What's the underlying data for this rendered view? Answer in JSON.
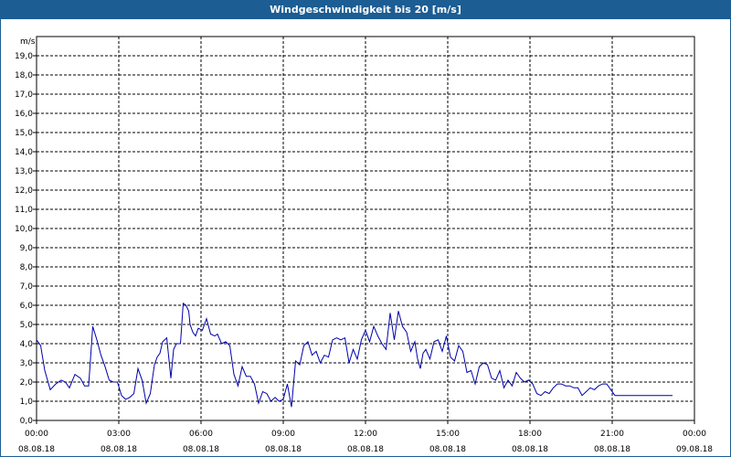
{
  "chart_data": {
    "type": "line",
    "title": "Windgeschwindigkeit bis 20 [m/s]",
    "unit_label": "m/s",
    "ylim": [
      0,
      20
    ],
    "y_ticks": [
      0.0,
      1.0,
      2.0,
      3.0,
      4.0,
      5.0,
      6.0,
      7.0,
      8.0,
      9.0,
      10.0,
      11.0,
      12.0,
      13.0,
      14.0,
      15.0,
      16.0,
      17.0,
      18.0,
      19.0
    ],
    "y_tick_labels": [
      "0,0",
      "1,0",
      "2,0",
      "3,0",
      "4,0",
      "5,0",
      "6,0",
      "7,0",
      "8,0",
      "9,0",
      "10,0",
      "11,0",
      "12,0",
      "13,0",
      "14,0",
      "15,0",
      "16,0",
      "17,0",
      "18,0",
      "19,0"
    ],
    "xlim_hours": [
      0,
      24
    ],
    "x_ticks_hours": [
      0,
      3,
      6,
      9,
      12,
      15,
      18,
      21,
      24
    ],
    "x_tick_times": [
      "00:00",
      "03:00",
      "06:00",
      "09:00",
      "12:00",
      "15:00",
      "18:00",
      "21:00",
      "00:00"
    ],
    "x_tick_dates": [
      "08.08.18",
      "08.08.18",
      "08.08.18",
      "08.08.18",
      "08.08.18",
      "08.08.18",
      "08.08.18",
      "08.08.18",
      "09.08.18"
    ],
    "grid": true,
    "line_color": "#0000aa",
    "series": [
      {
        "x_hours": [
          0.0,
          0.15,
          0.3,
          0.5,
          0.7,
          0.9,
          1.05,
          1.2,
          1.4,
          1.6,
          1.75,
          1.9,
          2.05,
          2.2,
          2.35,
          2.5,
          2.65,
          2.8,
          2.95,
          3.1,
          3.25,
          3.4,
          3.55,
          3.7,
          3.85,
          4.0,
          4.15,
          4.3,
          4.4,
          4.5,
          4.6,
          4.75,
          4.9,
          5.0,
          5.1,
          5.25,
          5.35,
          5.45,
          5.55,
          5.6,
          5.7,
          5.8,
          5.9,
          6.05,
          6.2,
          6.35,
          6.5,
          6.6,
          6.75,
          6.9,
          7.05,
          7.2,
          7.35,
          7.5,
          7.65,
          7.8,
          7.95,
          8.1,
          8.25,
          8.4,
          8.55,
          8.7,
          8.85,
          9.0,
          9.15,
          9.3,
          9.45,
          9.6,
          9.75,
          9.9,
          10.05,
          10.2,
          10.35,
          10.5,
          10.65,
          10.8,
          10.95,
          11.1,
          11.25,
          11.4,
          11.55,
          11.7,
          11.85,
          12.0,
          12.15,
          12.3,
          12.45,
          12.6,
          12.75,
          12.9,
          13.05,
          13.2,
          13.35,
          13.5,
          13.65,
          13.8,
          13.9,
          14.0,
          14.1,
          14.2,
          14.35,
          14.5,
          14.65,
          14.8,
          14.95,
          15.1,
          15.25,
          15.4,
          15.55,
          15.7,
          15.85,
          16.0,
          16.15,
          16.3,
          16.45,
          16.6,
          16.75,
          16.9,
          17.05,
          17.2,
          17.35,
          17.5,
          17.65,
          17.8,
          17.95,
          18.1,
          18.25,
          18.4,
          18.55,
          18.7,
          18.85,
          19.0,
          19.15,
          19.3,
          19.45,
          19.6,
          19.75,
          19.9,
          20.05,
          20.2,
          20.35,
          20.5,
          20.65,
          20.8,
          20.95,
          21.1,
          21.25,
          21.4,
          21.55,
          21.7,
          21.85,
          22.0,
          22.15,
          22.3,
          22.45,
          22.6,
          22.75,
          22.9,
          23.05,
          23.2,
          23.35,
          23.5,
          23.65,
          23.8
        ],
        "y": [
          4.2,
          3.9,
          2.6,
          1.6,
          1.9,
          2.1,
          2.0,
          1.7,
          2.4,
          2.2,
          1.8,
          1.8,
          4.9,
          4.2,
          3.4,
          2.8,
          2.1,
          2.0,
          2.0,
          1.3,
          1.1,
          1.2,
          1.4,
          2.7,
          2.1,
          0.9,
          1.4,
          2.9,
          3.3,
          3.5,
          4.1,
          4.3,
          2.2,
          3.7,
          4.0,
          4.0,
          6.1,
          6.0,
          5.7,
          5.0,
          4.6,
          4.4,
          4.8,
          4.7,
          5.3,
          4.5,
          4.4,
          4.5,
          4.0,
          4.1,
          3.9,
          2.4,
          1.8,
          2.8,
          2.3,
          2.3,
          1.9,
          0.9,
          1.5,
          1.4,
          1.0,
          1.2,
          1.0,
          1.1,
          1.9,
          0.7,
          3.1,
          2.9,
          3.9,
          4.1,
          3.4,
          3.6,
          3.0,
          3.4,
          3.3,
          4.2,
          4.3,
          4.2,
          4.3,
          3.0,
          3.7,
          3.2,
          4.2,
          4.7,
          4.1,
          4.9,
          4.4,
          4.0,
          3.7,
          5.6,
          4.2,
          5.7,
          4.9,
          4.6,
          3.6,
          4.1,
          3.2,
          2.7,
          3.5,
          3.7,
          3.2,
          4.1,
          4.2,
          3.6,
          4.4,
          3.3,
          3.1,
          3.9,
          3.6,
          2.5,
          2.6,
          1.9,
          2.8,
          3.0,
          2.9,
          2.2,
          2.1,
          2.6,
          1.7,
          2.1,
          1.8,
          2.5,
          2.2,
          2.0,
          2.1,
          1.9,
          1.4,
          1.3,
          1.5,
          1.4,
          1.7,
          1.9,
          1.9,
          1.8,
          1.8,
          1.7,
          1.7,
          1.3,
          1.5,
          1.7,
          1.6,
          1.8,
          1.9,
          1.9,
          1.6,
          1.3,
          1.3,
          1.3,
          1.3,
          1.3,
          1.3,
          1.3,
          1.3,
          1.3,
          1.3,
          1.3,
          1.3,
          1.3,
          1.3,
          1.3
        ]
      }
    ]
  }
}
